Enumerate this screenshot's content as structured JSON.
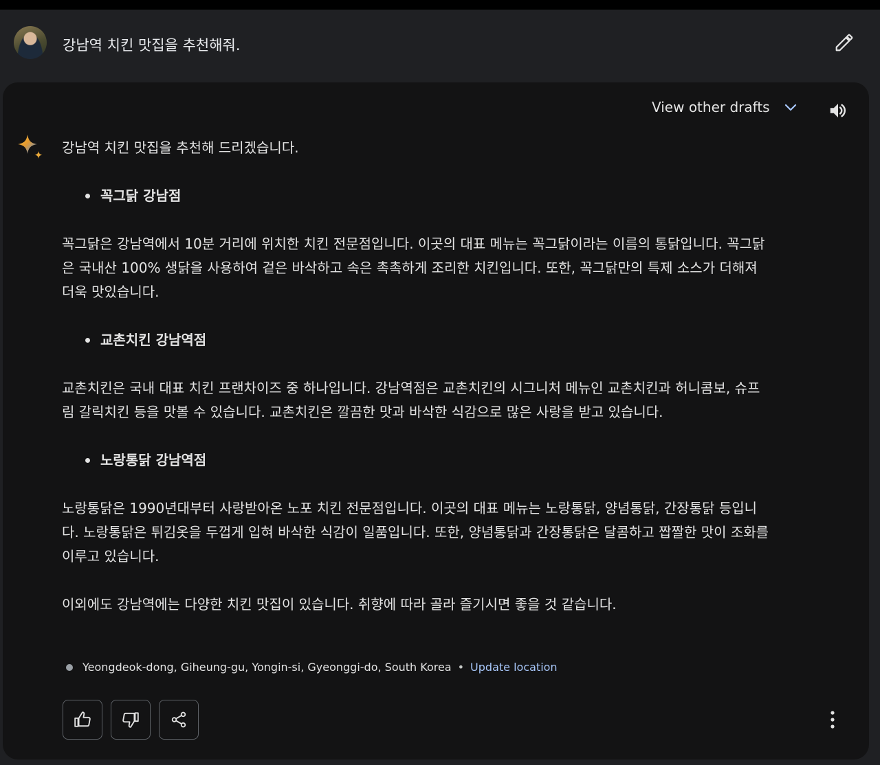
{
  "prompt": {
    "text": "강남역 치킨 맛집을 추천해줘."
  },
  "header": {
    "drafts_label": "View other drafts"
  },
  "response": {
    "intro": "강남역 치킨 맛집을 추천해 드리겠습니다.",
    "items": [
      {
        "title": "꼭그닭 강남점",
        "lines": [
          "꼭그닭은 강남역에서 10분 거리에 위치한 치킨 전문점입니다. 이곳의 대표 메뉴는 꼭그닭이라는 이름의 통닭입니다. 꼭그닭",
          "은 국내산 100% 생닭을 사용하여 겉은 바삭하고 속은 촉촉하게 조리한 치킨입니다. 또한, 꼭그닭만의 특제 소스가 더해져",
          "더욱 맛있습니다."
        ]
      },
      {
        "title": "교촌치킨 강남역점",
        "lines": [
          "교촌치킨은 국내 대표 치킨 프랜차이즈 중 하나입니다. 강남역점은 교촌치킨의 시그니처 메뉴인 교촌치킨과 허니콤보, 슈프",
          "림 갈릭치킨 등을 맛볼 수 있습니다. 교촌치킨은 깔끔한 맛과 바삭한 식감으로 많은 사랑을 받고 있습니다."
        ]
      },
      {
        "title": "노랑통닭 강남역점",
        "lines": [
          "노랑통닭은 1990년대부터 사랑받아온 노포 치킨 전문점입니다. 이곳의 대표 메뉴는 노랑통닭, 양념통닭, 간장통닭 등입니",
          "다. 노랑통닭은 튀김옷을 두껍게 입혀 바삭한 식감이 일품입니다. 또한, 양념통닭과 간장통닭은 달콤하고 짭짤한 맛이 조화를",
          "이루고 있습니다."
        ]
      }
    ],
    "outro": "이외에도 강남역에는 다양한 치킨 맛집이 있습니다. 취향에 따라 골라 즐기시면 좋을 것 같습니다."
  },
  "location": {
    "text": "Yeongdeok-dong, Giheung-gu, Yongin-si, Gyeonggi-do, South Korea",
    "separator": "•",
    "update_label": "Update location"
  },
  "icons": {
    "avatar": "user-avatar",
    "edit": "pencil-icon",
    "chevron": "chevron-down-icon",
    "speaker": "speaker-icon",
    "sparkle": "sparkle-icon",
    "thumbs_up": "thumbs-up-icon",
    "thumbs_down": "thumbs-down-icon",
    "share": "share-icon",
    "more": "more-vert-icon"
  },
  "colors": {
    "page_bg": "#1f2023",
    "card_bg": "#131314",
    "text": "#e3e3e3",
    "link": "#a8c7fa",
    "border": "#5f6368"
  }
}
